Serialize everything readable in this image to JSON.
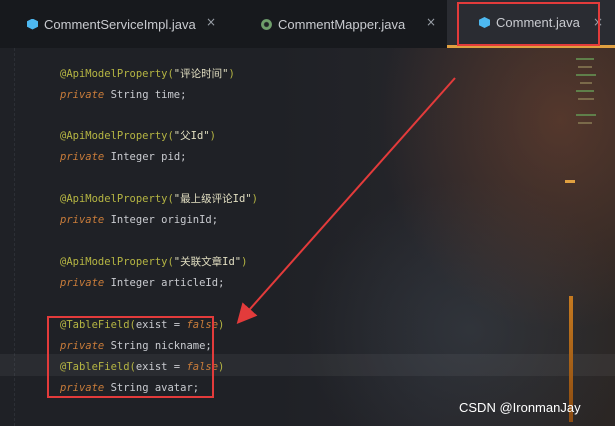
{
  "tabs": [
    {
      "label": "CommentServiceImpl.java",
      "icon": "java-class-icon",
      "close": "×"
    },
    {
      "label": "CommentMapper.java",
      "icon": "mapper-interface-icon",
      "close": "×"
    },
    {
      "label": "Comment.java",
      "icon": "java-class-icon",
      "close": "×",
      "active": true
    }
  ],
  "code": {
    "l1": {
      "ann": "@ApiModelProperty(",
      "str": "\"评论时间\"",
      "end": ")"
    },
    "l2": {
      "kw": "private",
      "type": " String ",
      "name": "time;"
    },
    "l3": {
      "ann": "@ApiModelProperty(",
      "str": "\"父Id\"",
      "end": ")"
    },
    "l4": {
      "kw": "private",
      "type": " Integer ",
      "name": "pid;"
    },
    "l5": {
      "ann": "@ApiModelProperty(",
      "str": "\"最上级评论Id\"",
      "end": ")"
    },
    "l6": {
      "kw": "private",
      "type": " Integer ",
      "name": "originId;"
    },
    "l7": {
      "ann": "@ApiModelProperty(",
      "str": "\"关联文章Id\"",
      "end": ")"
    },
    "l8": {
      "kw": "private",
      "type": " Integer ",
      "name": "articleId;"
    },
    "l9": {
      "ann": "@TableField(",
      "arg": "exist = ",
      "val": "false",
      "end": ")"
    },
    "l10": {
      "kw": "private",
      "type": " String ",
      "name": "nickname;"
    },
    "l11": {
      "ann": "@TableField(",
      "arg": "exist = ",
      "val": "false",
      "end": ")"
    },
    "l12": {
      "kw": "private",
      "type": " String ",
      "name": "avatar;"
    }
  },
  "watermark": "CSDN @IronmanJay",
  "colors": {
    "annotation": "#b5b543",
    "keyword": "#c97c3a",
    "highlight_box": "#e33b3b",
    "active_tab_underline": "#e0a040"
  }
}
